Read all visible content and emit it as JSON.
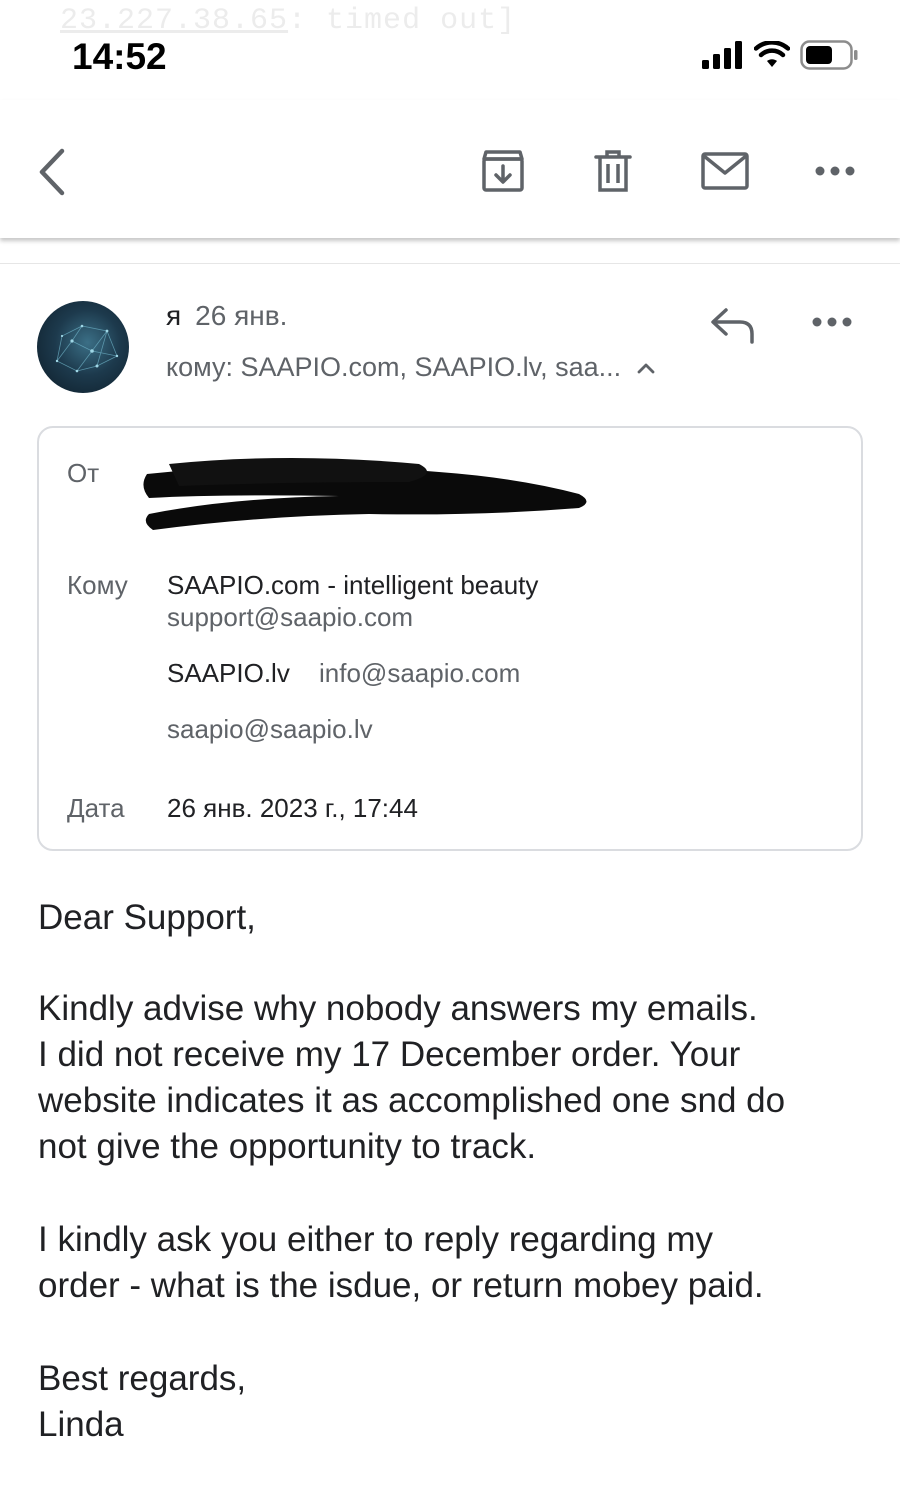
{
  "status_bar": {
    "ghost_ip": "23.227.38.65",
    "ghost_rest": ": timed out]",
    "time": "14:52"
  },
  "toolbar": {
    "icons": [
      "back-icon",
      "archive-icon",
      "trash-icon",
      "mark-unread-icon",
      "more-icon"
    ]
  },
  "message": {
    "sender": "я",
    "date_short": "26 янв.",
    "to_summary": "кому: SAAPIO.com, SAAPIO.lv, saa...",
    "details": {
      "from_label": "От",
      "to_label": "Кому",
      "recipient1_name": "SAAPIO.com - intelligent beauty",
      "recipient1_email": "support@saapio.com",
      "recipient2_name": "SAAPIO.lv",
      "recipient2_email": "info@saapio.com",
      "recipient3_email": "saapio@saapio.lv",
      "date_label": "Дата",
      "date_full": "26 янв. 2023 г., 17:44"
    },
    "body": {
      "greeting": "Dear Support,",
      "p1_l1": "Kindly advise why nobody answers my emails.",
      "p1_l2": "I did not receive my 17 December order. Your",
      "p1_l3": "website indicates it as accomplished one snd do",
      "p1_l4": "not give the opportunity to track.",
      "p2_l1": "I kindly ask you either to reply regarding my",
      "p2_l2": "order - what is the isdue, or return mobey paid.",
      "closing": "Best regards,",
      "signature": "Linda"
    }
  }
}
